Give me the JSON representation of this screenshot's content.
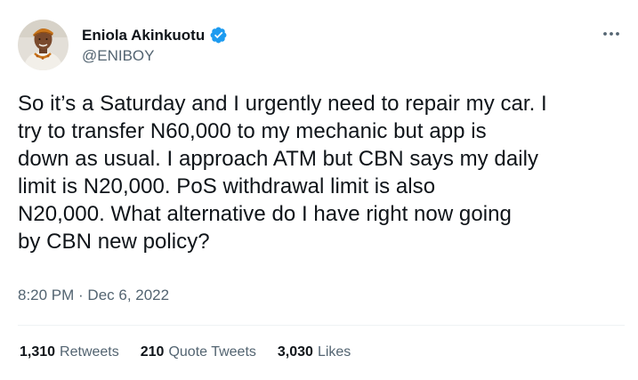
{
  "author": {
    "name": "Eniola Akinkuotu",
    "handle": "@ENIBOY",
    "verified": true,
    "verified_color": "#1d9bf0",
    "avatar_icon": "profile-photo"
  },
  "more_icon": "ellipsis-icon",
  "tweet": {
    "lines": [
      "So it’s a Saturday and I urgently need to repair my car. I",
      "try to transfer N60,000 to my mechanic but app is",
      "down as usual. I approach ATM but CBN says my daily",
      "limit is N20,000. PoS withdrawal limit is also",
      "N20,000. What alternative do I have right now going",
      "by CBN new policy?"
    ]
  },
  "timestamp": "8:20 PM · Dec 6, 2022",
  "stats": [
    {
      "count": "1,310",
      "label": "Retweets"
    },
    {
      "count": "210",
      "label": "Quote Tweets"
    },
    {
      "count": "3,030",
      "label": "Likes"
    }
  ]
}
